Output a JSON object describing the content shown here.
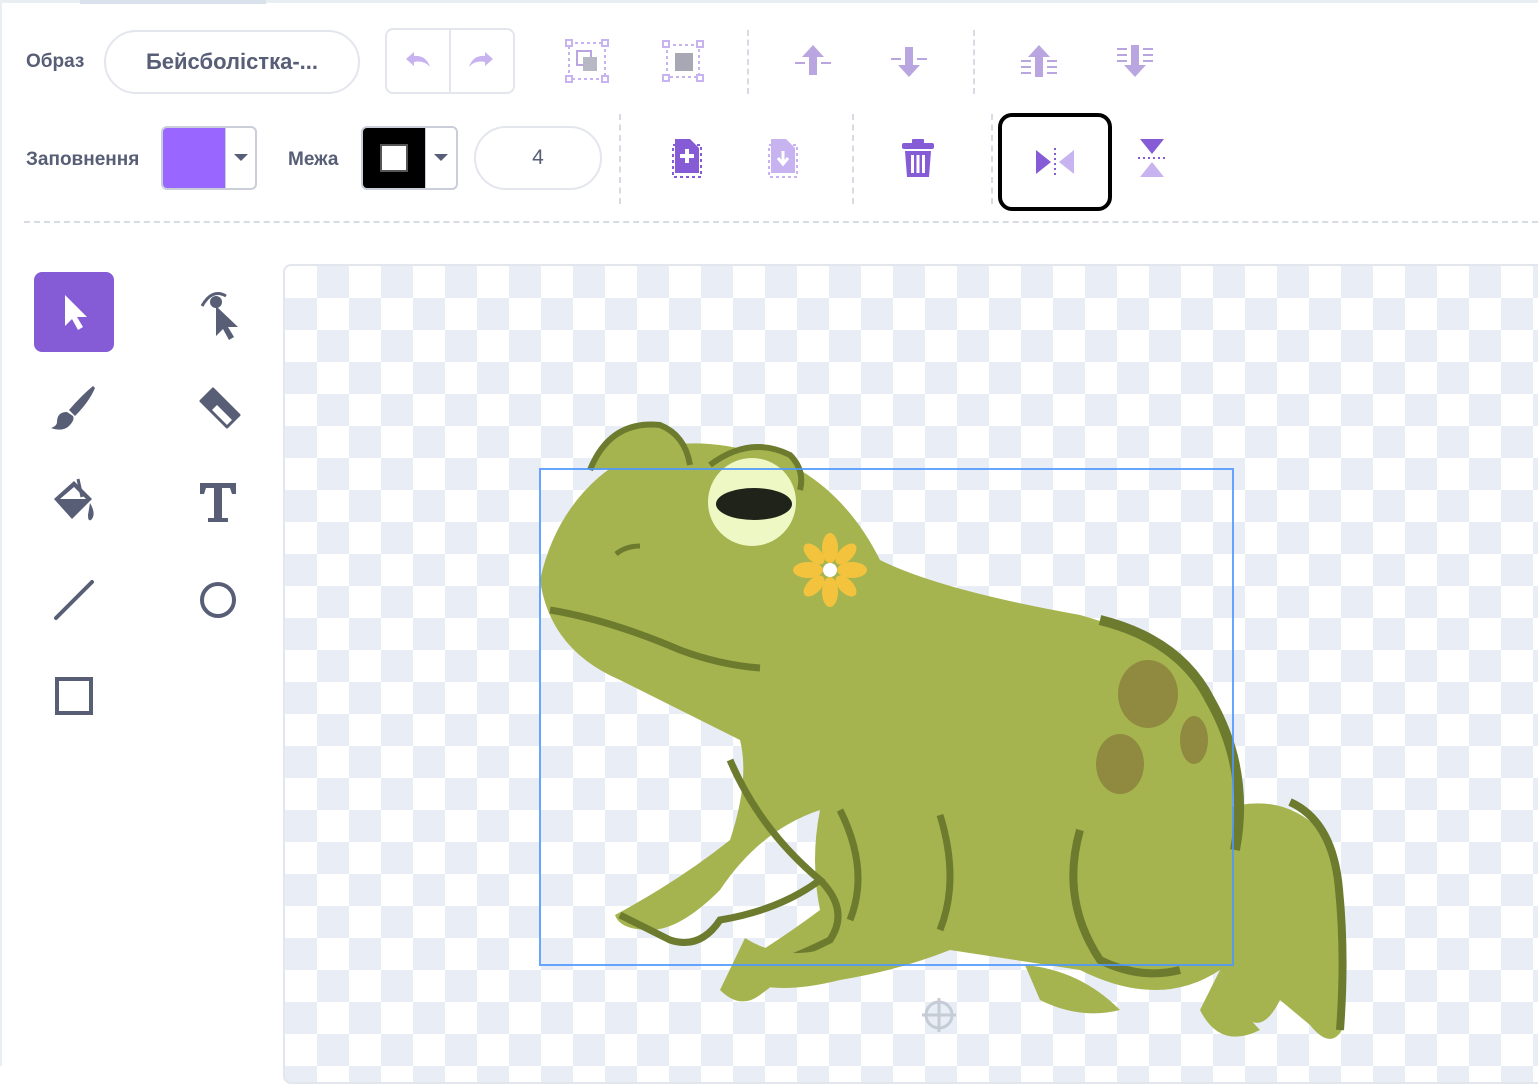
{
  "toolbar": {
    "costume_label": "Образ",
    "costume_name": "Бейсболістка-...",
    "fill_label": "Заповнення",
    "outline_label": "Межа",
    "outline_width": "4"
  },
  "icons": {
    "undo": "undo-icon",
    "redo": "redo-icon",
    "group": "group-icon",
    "ungroup": "ungroup-icon",
    "forward": "forward-icon",
    "backward": "backward-icon",
    "front": "bring-to-front-icon",
    "back": "send-to-back-icon",
    "copy": "copy-icon",
    "paste": "paste-icon",
    "delete": "delete-icon",
    "flip_h": "flip-horizontal-icon",
    "flip_v": "flip-vertical-icon"
  },
  "colors": {
    "accent": "#855cd6",
    "fill": "#9966ff",
    "outline": "#000000",
    "selection": "#4c97ff",
    "frog_body": "#a6b44f",
    "frog_shadow": "#6d7b2f"
  },
  "tools": [
    "select",
    "reshape",
    "brush",
    "eraser",
    "fill",
    "text",
    "line",
    "circle",
    "rectangle"
  ],
  "selected_tool": "select"
}
